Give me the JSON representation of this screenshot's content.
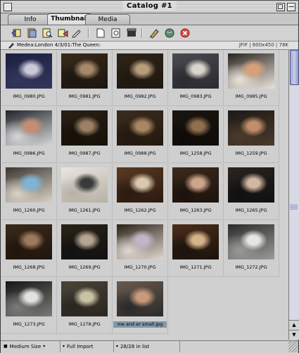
{
  "window": {
    "title": "Catalog #1"
  },
  "tabs": [
    {
      "label": "Info",
      "active": false
    },
    {
      "label": "Thumbnail",
      "active": true
    },
    {
      "label": "Media",
      "active": false
    }
  ],
  "toolbar": {
    "icons": [
      "back-icon",
      "catalog-icon",
      "find-icon",
      "sort-icon",
      "edit-icon",
      "page-icon",
      "zoom-icon",
      "slideshow-icon",
      "edit-pencil-icon",
      "globe-icon",
      "delete-icon"
    ]
  },
  "info_strip": {
    "path": "Medea:London 4/3/01:The Queen:",
    "format": "JFIF",
    "dimensions": "600x450",
    "size": "78K"
  },
  "thumbnails": [
    {
      "name": "IMG_0980.JPG",
      "palette": [
        "#1b2040",
        "#c9c9d8",
        "#33365c"
      ]
    },
    {
      "name": "IMG_0981.JPG",
      "palette": [
        "#3a2a1a",
        "#a6896a",
        "#1c1510"
      ]
    },
    {
      "name": "IMG_0982.JPG",
      "palette": [
        "#2e2418",
        "#b79d7c",
        "#201810"
      ]
    },
    {
      "name": "IMG_0983.JPG",
      "palette": [
        "#4b4a4f",
        "#d9d5cc",
        "#2a2a30"
      ]
    },
    {
      "name": "IMG_0985.JPG",
      "palette": [
        "#2a2420",
        "#d6a07a",
        "#e9e3d9"
      ]
    },
    {
      "name": "IMG_0986.JPG",
      "palette": [
        "#20242a",
        "#c28f73",
        "#d6d6d8"
      ]
    },
    {
      "name": "IMG_0987.JPG",
      "palette": [
        "#2a2016",
        "#9c8264",
        "#161008"
      ]
    },
    {
      "name": "IMG_0988.JPG",
      "palette": [
        "#3b2c1f",
        "#a88863",
        "#23180e"
      ]
    },
    {
      "name": "IMG_1258.JPG",
      "palette": [
        "#1a1610",
        "#8f6f4e",
        "#0e0b08"
      ]
    },
    {
      "name": "IMG_1259.JPG",
      "palette": [
        "#1d1a18",
        "#c08e6a",
        "#4a3a2a"
      ]
    },
    {
      "name": "IMG_1260.JPG",
      "palette": [
        "#3a3530",
        "#7fb3d4",
        "#d9d2c5"
      ]
    },
    {
      "name": "IMG_1261.JPG",
      "palette": [
        "#e8e6e0",
        "#3a3a3a",
        "#b7b0a5"
      ]
    },
    {
      "name": "IMG_1262.JPG",
      "palette": [
        "#5a3a22",
        "#d9c8b0",
        "#2a1a10"
      ]
    },
    {
      "name": "IMG_1263.JPG",
      "palette": [
        "#3c2b1e",
        "#cda58a",
        "#1b120c"
      ]
    },
    {
      "name": "IMG_1265.JPG",
      "palette": [
        "#2a2420",
        "#d0b8a2",
        "#101010"
      ]
    },
    {
      "name": "IMG_1268.JPG",
      "palette": [
        "#3a2a1c",
        "#9e7a5c",
        "#20150c"
      ]
    },
    {
      "name": "IMG_1269.JPG",
      "palette": [
        "#2a2418",
        "#b5a590",
        "#111111"
      ]
    },
    {
      "name": "IMG_1270.JPG",
      "palette": [
        "#2a2218",
        "#bfb6c8",
        "#e0d8d0"
      ]
    },
    {
      "name": "IMG_1271.JPG",
      "palette": [
        "#4a2e1a",
        "#d6b48a",
        "#1a120b"
      ]
    },
    {
      "name": "IMG_1272.JPG",
      "palette": [
        "#2b2b2b",
        "#e6e6e3",
        "#9a9a98"
      ]
    },
    {
      "name": "IMG_1273.JPG",
      "palette": [
        "#151515",
        "#e2e2e0",
        "#7a7a78"
      ]
    },
    {
      "name": "IMG_1278.JPG",
      "palette": [
        "#4a4438",
        "#c9c3a5",
        "#2a2620"
      ]
    },
    {
      "name": "me and er small.jpg",
      "palette": [
        "#6a5a4e",
        "#c99a7c",
        "#2a2a2a"
      ],
      "selected": true
    }
  ],
  "statusbar": {
    "size_label": "Medium Size",
    "import_label": "Full Import",
    "count_label": "28/28 in list"
  }
}
